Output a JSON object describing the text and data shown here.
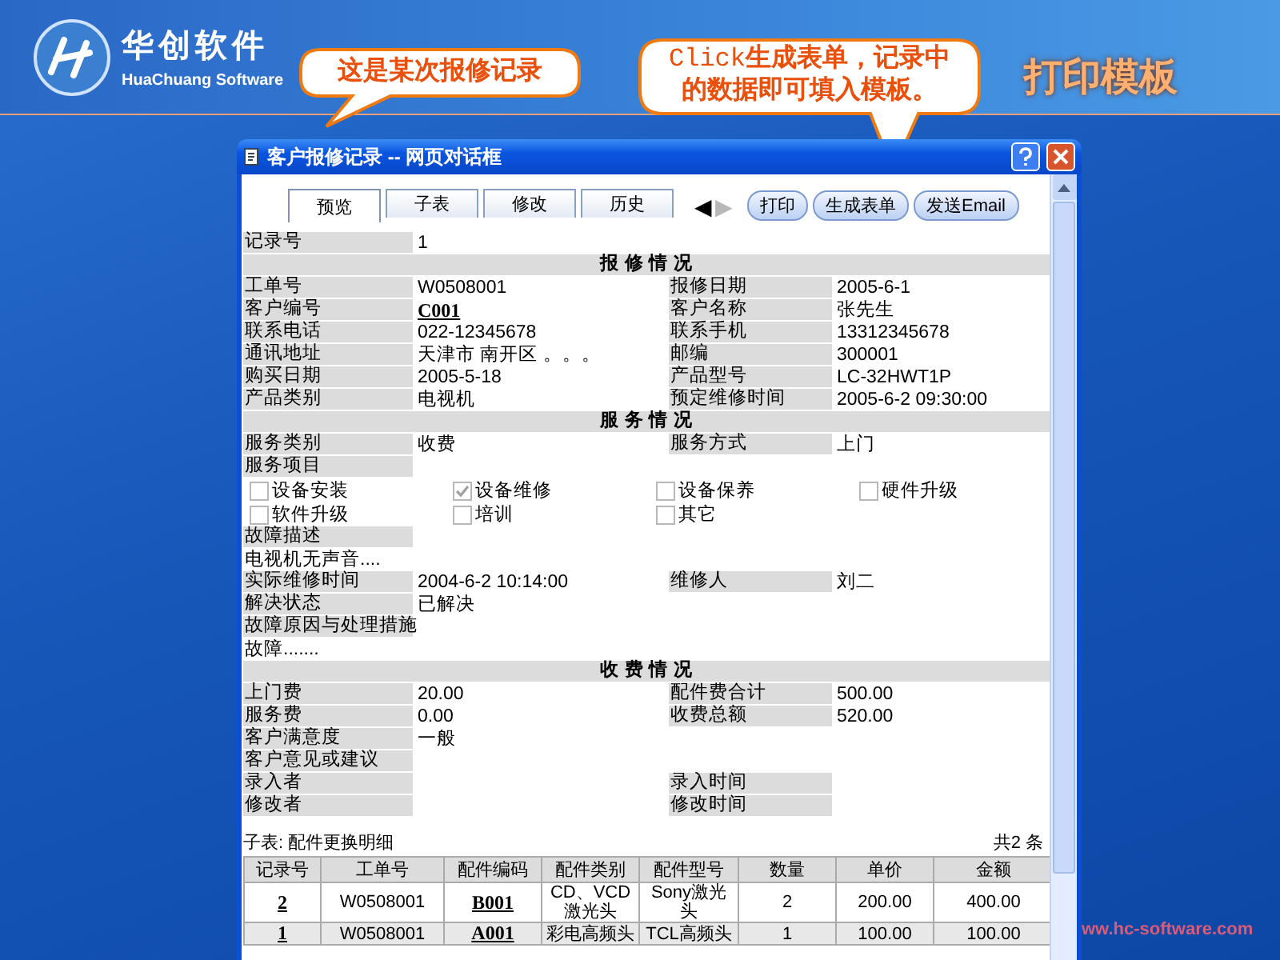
{
  "brand": {
    "name": "华创软件",
    "subtitle": "HuaChuang Software"
  },
  "callouts": [
    {
      "lines": [
        "这是某次报修记录"
      ]
    },
    {
      "lead": "Click",
      "lines": [
        "生成表单，记录中",
        "的数据即可填入模板。"
      ]
    }
  ],
  "headline": "打印模板",
  "footer_url": "ww.hc-software.com",
  "dialog": {
    "title": "客户报修记录 -- 网页对话框",
    "tabs": [
      {
        "label": "预览",
        "selected": true
      },
      {
        "label": "子表",
        "selected": false
      },
      {
        "label": "修改",
        "selected": false
      },
      {
        "label": "历史",
        "selected": false
      }
    ],
    "nav": [
      {
        "glyph": "◀",
        "disabled": false
      },
      {
        "glyph": "▶",
        "disabled": true
      }
    ],
    "buttons": [
      "打印",
      "生成表单",
      "发送Email"
    ],
    "form": [
      {
        "kind": "single",
        "label": "记录号",
        "value": "1"
      },
      {
        "kind": "header",
        "text": "报 修 情 况"
      },
      {
        "kind": "pair",
        "cells": [
          {
            "label": "工单号",
            "value": "W0508001"
          },
          {
            "label": "报修日期",
            "value": "2005-6-1"
          }
        ]
      },
      {
        "kind": "pair",
        "cells": [
          {
            "label": "客户编号",
            "value": "C001",
            "link": true
          },
          {
            "label": "客户名称",
            "value": "张先生"
          }
        ]
      },
      {
        "kind": "pair",
        "cells": [
          {
            "label": "联系电话",
            "value": "022-12345678"
          },
          {
            "label": "联系手机",
            "value": "13312345678"
          }
        ]
      },
      {
        "kind": "pair",
        "cells": [
          {
            "label": "通讯地址",
            "value": "天津市 南开区 。。。"
          },
          {
            "label": "邮编",
            "value": "300001"
          }
        ]
      },
      {
        "kind": "pair",
        "cells": [
          {
            "label": "购买日期",
            "value": "2005-5-18"
          },
          {
            "label": "产品型号",
            "value": "LC-32HWT1P"
          }
        ]
      },
      {
        "kind": "pair",
        "cells": [
          {
            "label": "产品类别",
            "value": "电视机"
          },
          {
            "label": "预定维修时间",
            "value": "2005-6-2 09:30:00"
          }
        ]
      },
      {
        "kind": "header",
        "text": "服 务 情 况"
      },
      {
        "kind": "pair",
        "cells": [
          {
            "label": "服务类别",
            "value": "收费"
          },
          {
            "label": "服务方式",
            "value": "上门"
          }
        ]
      },
      {
        "kind": "single",
        "label": "服务项目"
      },
      {
        "kind": "checks",
        "items": [
          {
            "label": "设备安装",
            "checked": false
          },
          {
            "label": "设备维修",
            "checked": true
          },
          {
            "label": "设备保养",
            "checked": false
          },
          {
            "label": "硬件升级",
            "checked": false
          }
        ]
      },
      {
        "kind": "checks",
        "items": [
          {
            "label": "软件升级",
            "checked": false
          },
          {
            "label": "培训",
            "checked": false
          },
          {
            "label": "其它",
            "checked": false
          }
        ]
      },
      {
        "kind": "single",
        "label": "故障描述"
      },
      {
        "kind": "text",
        "text": "电视机无声音...."
      },
      {
        "kind": "pair",
        "cells": [
          {
            "label": "实际维修时间",
            "value": "2004-6-2 10:14:00"
          },
          {
            "label": "维修人",
            "value": "刘二"
          }
        ]
      },
      {
        "kind": "single",
        "label": "解决状态",
        "value": "已解决"
      },
      {
        "kind": "single",
        "label": "故障原因与处理措施"
      },
      {
        "kind": "text",
        "text": "故障......."
      },
      {
        "kind": "header",
        "text": "收 费 情 况"
      },
      {
        "kind": "pair",
        "cells": [
          {
            "label": "上门费",
            "value": "20.00"
          },
          {
            "label": "配件费合计",
            "value": "500.00"
          }
        ]
      },
      {
        "kind": "pair",
        "cells": [
          {
            "label": "服务费",
            "value": "0.00"
          },
          {
            "label": "收费总额",
            "value": "520.00"
          }
        ]
      },
      {
        "kind": "single",
        "label": "客户满意度",
        "value": "一般"
      },
      {
        "kind": "single",
        "label": "客户意见或建议"
      },
      {
        "kind": "pair",
        "cells": [
          {
            "label": "录入者"
          },
          {
            "label": "录入时间"
          }
        ]
      },
      {
        "kind": "pair",
        "cells": [
          {
            "label": "修改者"
          },
          {
            "label": "修改时间"
          }
        ]
      }
    ],
    "subtable": {
      "caption": "子表: 配件更换明细",
      "count": "共2 条",
      "columns": [
        {
          "label": "记录号",
          "link": true
        },
        {
          "label": "工单号"
        },
        {
          "label": "配件编码",
          "link": true
        },
        {
          "label": "配件类别"
        },
        {
          "label": "配件型号"
        },
        {
          "label": "数量"
        },
        {
          "label": "单价"
        },
        {
          "label": "金额"
        }
      ],
      "rows": [
        [
          "2",
          "W0508001",
          "B001",
          "CD、VCD激光头",
          "Sony激光头",
          "2",
          "200.00",
          "400.00"
        ],
        [
          "1",
          "W0508001",
          "A001",
          "彩电高频头",
          "TCL高频头",
          "1",
          "100.00",
          "100.00"
        ]
      ]
    }
  }
}
